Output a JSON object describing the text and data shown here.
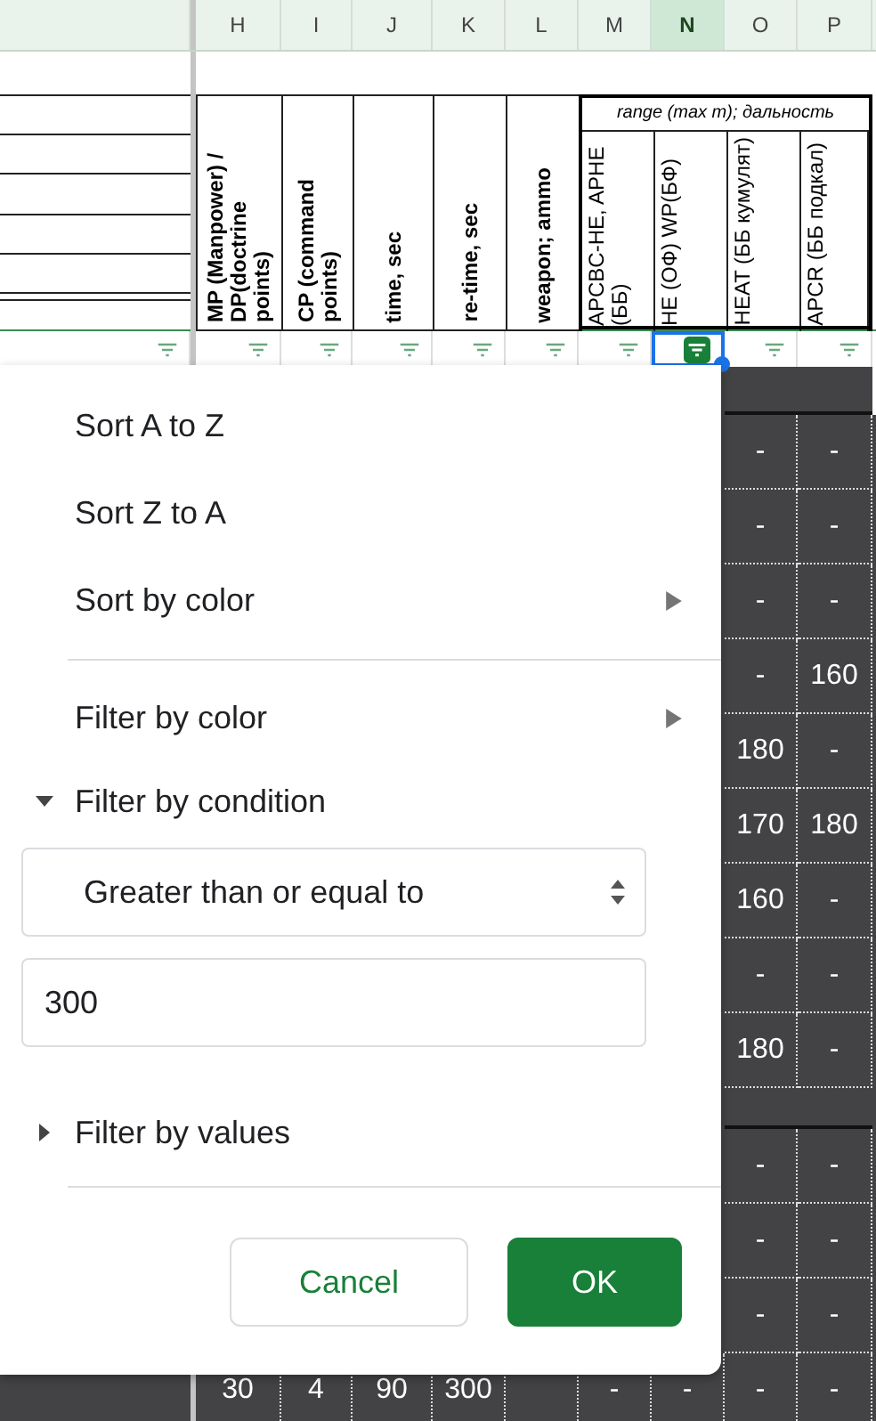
{
  "columns": [
    {
      "letter": "H",
      "selected": false
    },
    {
      "letter": "I",
      "selected": false
    },
    {
      "letter": "J",
      "selected": false
    },
    {
      "letter": "K",
      "selected": false
    },
    {
      "letter": "L",
      "selected": false
    },
    {
      "letter": "M",
      "selected": false
    },
    {
      "letter": "N",
      "selected": true
    },
    {
      "letter": "O",
      "selected": false
    },
    {
      "letter": "P",
      "selected": false
    }
  ],
  "headers": [
    "MP (Manpower) / DP(doctrine points)",
    "CP (command points)",
    "time, sec",
    "re-time, sec",
    "weapon; ammo"
  ],
  "range_group": {
    "title": "range (max m); дальность",
    "sub_headers": [
      "APCBC-HE, APHE (ББ)",
      "HE (ОФ) WP(БФ)",
      "HEAT (ББ кумулят)",
      "APCR (ББ подкал)"
    ]
  },
  "filters": [
    {
      "active": false
    },
    {
      "active": false
    },
    {
      "active": false
    },
    {
      "active": false
    },
    {
      "active": false
    },
    {
      "active": false
    },
    {
      "active": false
    },
    {
      "active": true
    },
    {
      "active": false
    },
    {
      "active": false
    }
  ],
  "rows": [
    {
      "o": "-",
      "p": "-"
    },
    {
      "o": "-",
      "p": "-"
    },
    {
      "o": "-",
      "p": "-"
    },
    {
      "o": "-",
      "p": "160"
    },
    {
      "o": "180",
      "p": "-"
    },
    {
      "o": "170",
      "p": "180"
    },
    {
      "o": "160",
      "p": "-"
    },
    {
      "o": "-",
      "p": "-"
    },
    {
      "o": "180",
      "p": "-"
    }
  ],
  "rows_after_break": [
    {
      "o": "-",
      "p": "-"
    },
    {
      "o": "-",
      "p": "-"
    },
    {
      "o": "-",
      "p": "-"
    }
  ],
  "last_row": {
    "h": "30",
    "i": "4",
    "j": "90",
    "k": "300",
    "m": "-",
    "n": "-",
    "o": "-",
    "p": "-"
  },
  "menu": {
    "sort_items": [
      {
        "label": "Sort A to Z",
        "submenu": false
      },
      {
        "label": "Sort Z to A",
        "submenu": false
      },
      {
        "label": "Sort by color",
        "submenu": true
      }
    ],
    "filter_by_color": {
      "label": "Filter by color"
    },
    "filter_by_condition": {
      "label": "Filter by condition",
      "expanded": true,
      "condition": "Greater than or equal to",
      "value": "300"
    },
    "filter_by_values": {
      "label": "Filter by values",
      "expanded": false
    },
    "buttons": [
      {
        "label": "Cancel",
        "kind": "secondary"
      },
      {
        "label": "OK",
        "kind": "primary"
      }
    ]
  }
}
